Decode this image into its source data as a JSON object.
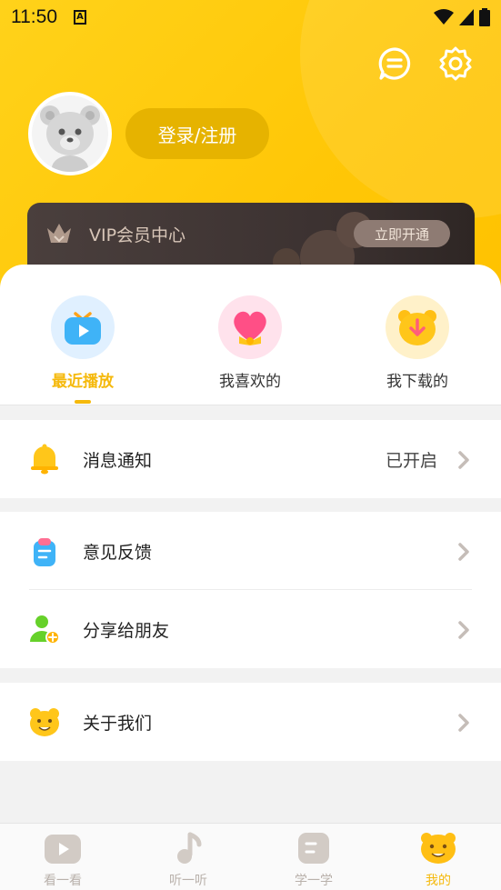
{
  "status_bar": {
    "time": "11:50",
    "notif_icon": "a-icon"
  },
  "header": {
    "message_icon": "message-icon",
    "settings_icon": "settings-icon",
    "login_label": "登录/注册"
  },
  "vip": {
    "title": "VIP会员中心",
    "button_label": "立即开通"
  },
  "quick_tabs": [
    {
      "label": "最近播放",
      "icon": "tv-play-icon",
      "active": true
    },
    {
      "label": "我喜欢的",
      "icon": "heart-icon",
      "active": false
    },
    {
      "label": "我下载的",
      "icon": "download-bear-icon",
      "active": false
    }
  ],
  "menu": {
    "notify": {
      "label": "消息通知",
      "value": "已开启"
    },
    "feedback": {
      "label": "意见反馈"
    },
    "share": {
      "label": "分享给朋友"
    },
    "about": {
      "label": "关于我们"
    }
  },
  "tab_bar": [
    {
      "label": "看一看",
      "active": false
    },
    {
      "label": "听一听",
      "active": false
    },
    {
      "label": "学一学",
      "active": false
    },
    {
      "label": "我的",
      "active": true
    }
  ],
  "colors": {
    "accent": "#f5b90c",
    "header": "#ffc707",
    "vip_bg": "#3f3534"
  }
}
